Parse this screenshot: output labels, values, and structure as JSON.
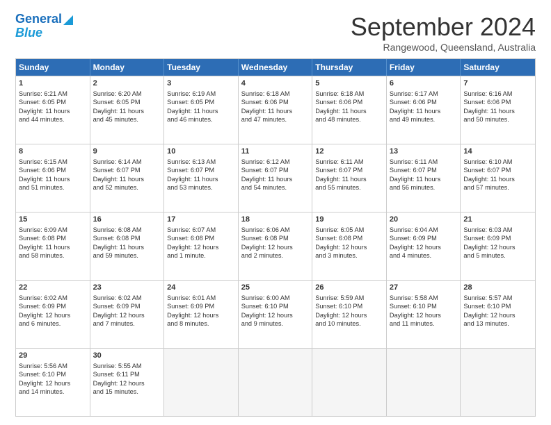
{
  "header": {
    "logo_line1": "General",
    "logo_line2": "Blue",
    "month": "September 2024",
    "location": "Rangewood, Queensland, Australia"
  },
  "days_of_week": [
    "Sunday",
    "Monday",
    "Tuesday",
    "Wednesday",
    "Thursday",
    "Friday",
    "Saturday"
  ],
  "weeks": [
    [
      {
        "day": 1,
        "info": "Sunrise: 6:21 AM\nSunset: 6:05 PM\nDaylight: 11 hours\nand 44 minutes."
      },
      {
        "day": 2,
        "info": "Sunrise: 6:20 AM\nSunset: 6:05 PM\nDaylight: 11 hours\nand 45 minutes."
      },
      {
        "day": 3,
        "info": "Sunrise: 6:19 AM\nSunset: 6:05 PM\nDaylight: 11 hours\nand 46 minutes."
      },
      {
        "day": 4,
        "info": "Sunrise: 6:18 AM\nSunset: 6:06 PM\nDaylight: 11 hours\nand 47 minutes."
      },
      {
        "day": 5,
        "info": "Sunrise: 6:18 AM\nSunset: 6:06 PM\nDaylight: 11 hours\nand 48 minutes."
      },
      {
        "day": 6,
        "info": "Sunrise: 6:17 AM\nSunset: 6:06 PM\nDaylight: 11 hours\nand 49 minutes."
      },
      {
        "day": 7,
        "info": "Sunrise: 6:16 AM\nSunset: 6:06 PM\nDaylight: 11 hours\nand 50 minutes."
      }
    ],
    [
      {
        "day": 8,
        "info": "Sunrise: 6:15 AM\nSunset: 6:06 PM\nDaylight: 11 hours\nand 51 minutes."
      },
      {
        "day": 9,
        "info": "Sunrise: 6:14 AM\nSunset: 6:07 PM\nDaylight: 11 hours\nand 52 minutes."
      },
      {
        "day": 10,
        "info": "Sunrise: 6:13 AM\nSunset: 6:07 PM\nDaylight: 11 hours\nand 53 minutes."
      },
      {
        "day": 11,
        "info": "Sunrise: 6:12 AM\nSunset: 6:07 PM\nDaylight: 11 hours\nand 54 minutes."
      },
      {
        "day": 12,
        "info": "Sunrise: 6:11 AM\nSunset: 6:07 PM\nDaylight: 11 hours\nand 55 minutes."
      },
      {
        "day": 13,
        "info": "Sunrise: 6:11 AM\nSunset: 6:07 PM\nDaylight: 11 hours\nand 56 minutes."
      },
      {
        "day": 14,
        "info": "Sunrise: 6:10 AM\nSunset: 6:07 PM\nDaylight: 11 hours\nand 57 minutes."
      }
    ],
    [
      {
        "day": 15,
        "info": "Sunrise: 6:09 AM\nSunset: 6:08 PM\nDaylight: 11 hours\nand 58 minutes."
      },
      {
        "day": 16,
        "info": "Sunrise: 6:08 AM\nSunset: 6:08 PM\nDaylight: 11 hours\nand 59 minutes."
      },
      {
        "day": 17,
        "info": "Sunrise: 6:07 AM\nSunset: 6:08 PM\nDaylight: 12 hours\nand 1 minute."
      },
      {
        "day": 18,
        "info": "Sunrise: 6:06 AM\nSunset: 6:08 PM\nDaylight: 12 hours\nand 2 minutes."
      },
      {
        "day": 19,
        "info": "Sunrise: 6:05 AM\nSunset: 6:08 PM\nDaylight: 12 hours\nand 3 minutes."
      },
      {
        "day": 20,
        "info": "Sunrise: 6:04 AM\nSunset: 6:09 PM\nDaylight: 12 hours\nand 4 minutes."
      },
      {
        "day": 21,
        "info": "Sunrise: 6:03 AM\nSunset: 6:09 PM\nDaylight: 12 hours\nand 5 minutes."
      }
    ],
    [
      {
        "day": 22,
        "info": "Sunrise: 6:02 AM\nSunset: 6:09 PM\nDaylight: 12 hours\nand 6 minutes."
      },
      {
        "day": 23,
        "info": "Sunrise: 6:02 AM\nSunset: 6:09 PM\nDaylight: 12 hours\nand 7 minutes."
      },
      {
        "day": 24,
        "info": "Sunrise: 6:01 AM\nSunset: 6:09 PM\nDaylight: 12 hours\nand 8 minutes."
      },
      {
        "day": 25,
        "info": "Sunrise: 6:00 AM\nSunset: 6:10 PM\nDaylight: 12 hours\nand 9 minutes."
      },
      {
        "day": 26,
        "info": "Sunrise: 5:59 AM\nSunset: 6:10 PM\nDaylight: 12 hours\nand 10 minutes."
      },
      {
        "day": 27,
        "info": "Sunrise: 5:58 AM\nSunset: 6:10 PM\nDaylight: 12 hours\nand 11 minutes."
      },
      {
        "day": 28,
        "info": "Sunrise: 5:57 AM\nSunset: 6:10 PM\nDaylight: 12 hours\nand 13 minutes."
      }
    ],
    [
      {
        "day": 29,
        "info": "Sunrise: 5:56 AM\nSunset: 6:10 PM\nDaylight: 12 hours\nand 14 minutes."
      },
      {
        "day": 30,
        "info": "Sunrise: 5:55 AM\nSunset: 6:11 PM\nDaylight: 12 hours\nand 15 minutes."
      },
      {
        "day": null,
        "info": ""
      },
      {
        "day": null,
        "info": ""
      },
      {
        "day": null,
        "info": ""
      },
      {
        "day": null,
        "info": ""
      },
      {
        "day": null,
        "info": ""
      }
    ]
  ]
}
